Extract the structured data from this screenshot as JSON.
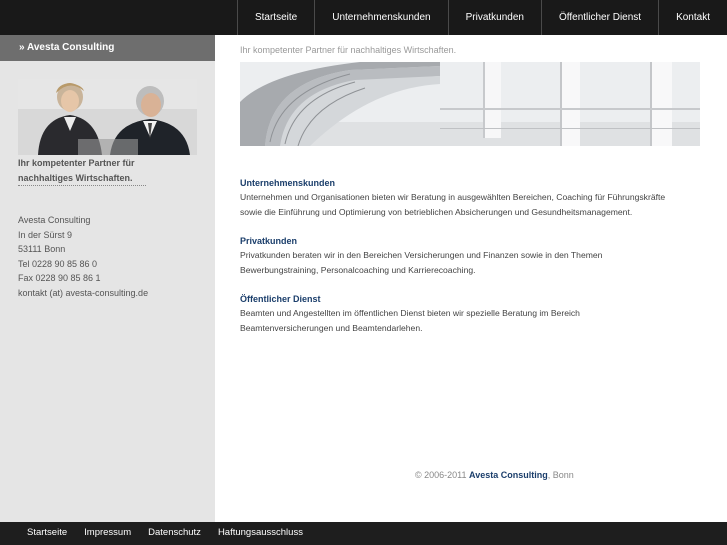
{
  "top_nav": {
    "items": [
      "Startseite",
      "Unternehmenskunden",
      "Privatkunden",
      "Öffentlicher Dienst",
      "Kontakt"
    ]
  },
  "sidebar": {
    "header": "» Avesta Consulting",
    "tagline_line1": "Ihr kompetenter Partner für",
    "tagline_line2": "nachhaltiges Wirtschaften.",
    "address": [
      "Avesta Consulting",
      "In der Sürst 9",
      "53111 Bonn",
      "Tel 0228 90 85 86 0",
      "Fax 0228 90 85 86 1",
      "kontakt (at) avesta-consulting.de"
    ]
  },
  "main": {
    "tagline": "Ihr kompetenter Partner für nachhaltiges Wirtschaften.",
    "sections": [
      {
        "title": "Unternehmenskunden",
        "line1": "Unternehmen und Organisationen bieten wir Beratung in ausgewählten Bereichen, Coaching für Führungskräfte",
        "line2": "sowie die Einführung und Optimierung von betrieblichen Absicherungen und Gesundheitsmanagement."
      },
      {
        "title": "Privatkunden",
        "line1": "Privatkunden beraten wir in den Bereichen Versicherungen und Finanzen sowie in den Themen",
        "line2": "Bewerbungstraining, Personalcoaching und Karrierecoaching."
      },
      {
        "title": "Öffentlicher Dienst",
        "line1": "Beamten und Angestellten im öffentlichen Dienst bieten wir spezielle Beratung im Bereich",
        "line2": "Beamtenversicherungen und Beamtendarlehen."
      }
    ],
    "copyright_prefix": "© 2006-2011",
    "copyright_company": "Avesta Consulting",
    "copyright_suffix": ", Bonn"
  },
  "footer_nav": {
    "items": [
      "Startseite",
      "Impressum",
      "Datenschutz",
      "Haftungsausschluss"
    ]
  },
  "colors": {
    "topbar": "#191919",
    "sidebar_bg": "#e5e5e5",
    "sidebar_header": "#6e6e6e",
    "heading_blue": "#1b3e6b"
  }
}
